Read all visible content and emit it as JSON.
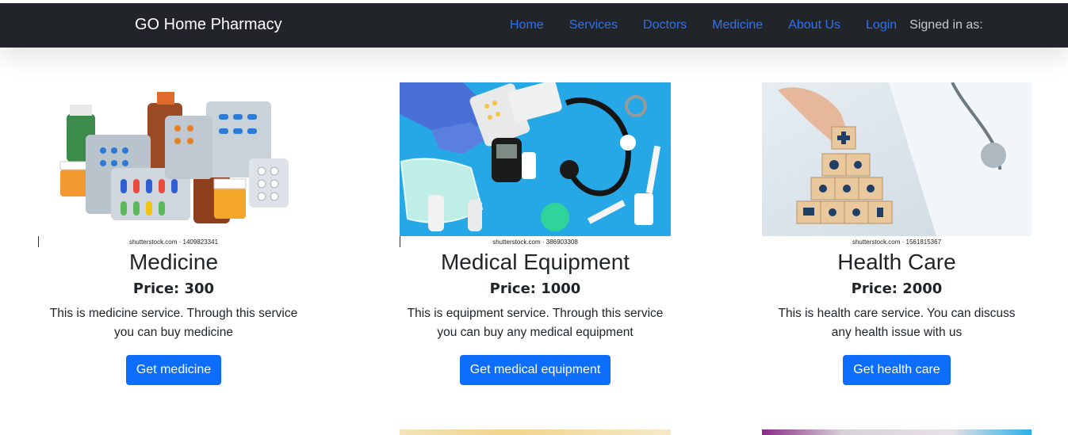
{
  "navbar": {
    "brand": "GO Home Pharmacy",
    "links": [
      "Home",
      "Services",
      "Doctors",
      "Medicine",
      "About Us",
      "Login"
    ],
    "signed_in": "Signed in as:"
  },
  "cards": [
    {
      "credit": "shutterstock.com · 1409823341",
      "title": "Medicine",
      "price": "Price: 300",
      "description": "This is medicine service. Through this service you can buy medicine",
      "button": "Get medicine"
    },
    {
      "credit": "shutterstock.com · 386903308",
      "title": "Medical Equipment",
      "price": "Price: 1000",
      "description": "This is equipment service. Through this service you can buy any medical equipment",
      "button": "Get medical equipment"
    },
    {
      "credit": "shutterstock.com · 1561815367",
      "title": "Health Care",
      "price": "Price: 2000",
      "description": "This is health care service. You can discuss any health issue with us",
      "button": "Get health care"
    }
  ],
  "colors": {
    "navbar": "#212529",
    "link": "#2f72f0",
    "button": "#0d6efd"
  }
}
